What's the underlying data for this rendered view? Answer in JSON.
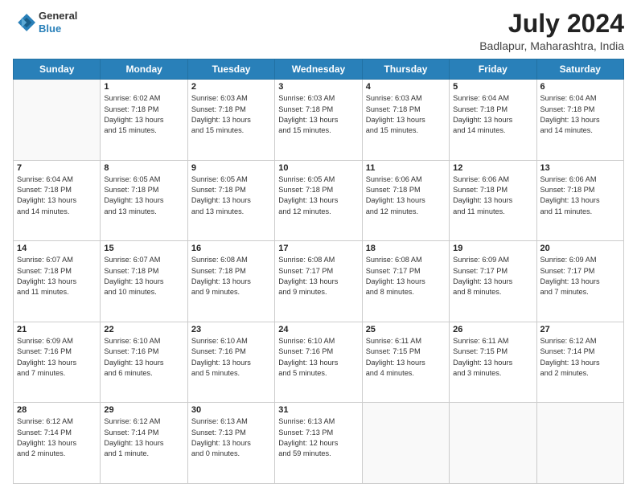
{
  "header": {
    "logo": {
      "line1": "General",
      "line2": "Blue"
    },
    "title": "July 2024",
    "location": "Badlapur, Maharashtra, India"
  },
  "days_of_week": [
    "Sunday",
    "Monday",
    "Tuesday",
    "Wednesday",
    "Thursday",
    "Friday",
    "Saturday"
  ],
  "weeks": [
    [
      {
        "day": "",
        "sunrise": "",
        "sunset": "",
        "daylight": ""
      },
      {
        "day": "1",
        "sunrise": "6:02 AM",
        "sunset": "7:18 PM",
        "daylight": "13 hours and 15 minutes."
      },
      {
        "day": "2",
        "sunrise": "6:03 AM",
        "sunset": "7:18 PM",
        "daylight": "13 hours and 15 minutes."
      },
      {
        "day": "3",
        "sunrise": "6:03 AM",
        "sunset": "7:18 PM",
        "daylight": "13 hours and 15 minutes."
      },
      {
        "day": "4",
        "sunrise": "6:03 AM",
        "sunset": "7:18 PM",
        "daylight": "13 hours and 15 minutes."
      },
      {
        "day": "5",
        "sunrise": "6:04 AM",
        "sunset": "7:18 PM",
        "daylight": "13 hours and 14 minutes."
      },
      {
        "day": "6",
        "sunrise": "6:04 AM",
        "sunset": "7:18 PM",
        "daylight": "13 hours and 14 minutes."
      }
    ],
    [
      {
        "day": "7",
        "sunrise": "6:04 AM",
        "sunset": "7:18 PM",
        "daylight": "13 hours and 14 minutes."
      },
      {
        "day": "8",
        "sunrise": "6:05 AM",
        "sunset": "7:18 PM",
        "daylight": "13 hours and 13 minutes."
      },
      {
        "day": "9",
        "sunrise": "6:05 AM",
        "sunset": "7:18 PM",
        "daylight": "13 hours and 13 minutes."
      },
      {
        "day": "10",
        "sunrise": "6:05 AM",
        "sunset": "7:18 PM",
        "daylight": "13 hours and 12 minutes."
      },
      {
        "day": "11",
        "sunrise": "6:06 AM",
        "sunset": "7:18 PM",
        "daylight": "13 hours and 12 minutes."
      },
      {
        "day": "12",
        "sunrise": "6:06 AM",
        "sunset": "7:18 PM",
        "daylight": "13 hours and 11 minutes."
      },
      {
        "day": "13",
        "sunrise": "6:06 AM",
        "sunset": "7:18 PM",
        "daylight": "13 hours and 11 minutes."
      }
    ],
    [
      {
        "day": "14",
        "sunrise": "6:07 AM",
        "sunset": "7:18 PM",
        "daylight": "13 hours and 11 minutes."
      },
      {
        "day": "15",
        "sunrise": "6:07 AM",
        "sunset": "7:18 PM",
        "daylight": "13 hours and 10 minutes."
      },
      {
        "day": "16",
        "sunrise": "6:08 AM",
        "sunset": "7:18 PM",
        "daylight": "13 hours and 9 minutes."
      },
      {
        "day": "17",
        "sunrise": "6:08 AM",
        "sunset": "7:17 PM",
        "daylight": "13 hours and 9 minutes."
      },
      {
        "day": "18",
        "sunrise": "6:08 AM",
        "sunset": "7:17 PM",
        "daylight": "13 hours and 8 minutes."
      },
      {
        "day": "19",
        "sunrise": "6:09 AM",
        "sunset": "7:17 PM",
        "daylight": "13 hours and 8 minutes."
      },
      {
        "day": "20",
        "sunrise": "6:09 AM",
        "sunset": "7:17 PM",
        "daylight": "13 hours and 7 minutes."
      }
    ],
    [
      {
        "day": "21",
        "sunrise": "6:09 AM",
        "sunset": "7:16 PM",
        "daylight": "13 hours and 7 minutes."
      },
      {
        "day": "22",
        "sunrise": "6:10 AM",
        "sunset": "7:16 PM",
        "daylight": "13 hours and 6 minutes."
      },
      {
        "day": "23",
        "sunrise": "6:10 AM",
        "sunset": "7:16 PM",
        "daylight": "13 hours and 5 minutes."
      },
      {
        "day": "24",
        "sunrise": "6:10 AM",
        "sunset": "7:16 PM",
        "daylight": "13 hours and 5 minutes."
      },
      {
        "day": "25",
        "sunrise": "6:11 AM",
        "sunset": "7:15 PM",
        "daylight": "13 hours and 4 minutes."
      },
      {
        "day": "26",
        "sunrise": "6:11 AM",
        "sunset": "7:15 PM",
        "daylight": "13 hours and 3 minutes."
      },
      {
        "day": "27",
        "sunrise": "6:12 AM",
        "sunset": "7:14 PM",
        "daylight": "13 hours and 2 minutes."
      }
    ],
    [
      {
        "day": "28",
        "sunrise": "6:12 AM",
        "sunset": "7:14 PM",
        "daylight": "13 hours and 2 minutes."
      },
      {
        "day": "29",
        "sunrise": "6:12 AM",
        "sunset": "7:14 PM",
        "daylight": "13 hours and 1 minute."
      },
      {
        "day": "30",
        "sunrise": "6:13 AM",
        "sunset": "7:13 PM",
        "daylight": "13 hours and 0 minutes."
      },
      {
        "day": "31",
        "sunrise": "6:13 AM",
        "sunset": "7:13 PM",
        "daylight": "12 hours and 59 minutes."
      },
      {
        "day": "",
        "sunrise": "",
        "sunset": "",
        "daylight": ""
      },
      {
        "day": "",
        "sunrise": "",
        "sunset": "",
        "daylight": ""
      },
      {
        "day": "",
        "sunrise": "",
        "sunset": "",
        "daylight": ""
      }
    ]
  ]
}
